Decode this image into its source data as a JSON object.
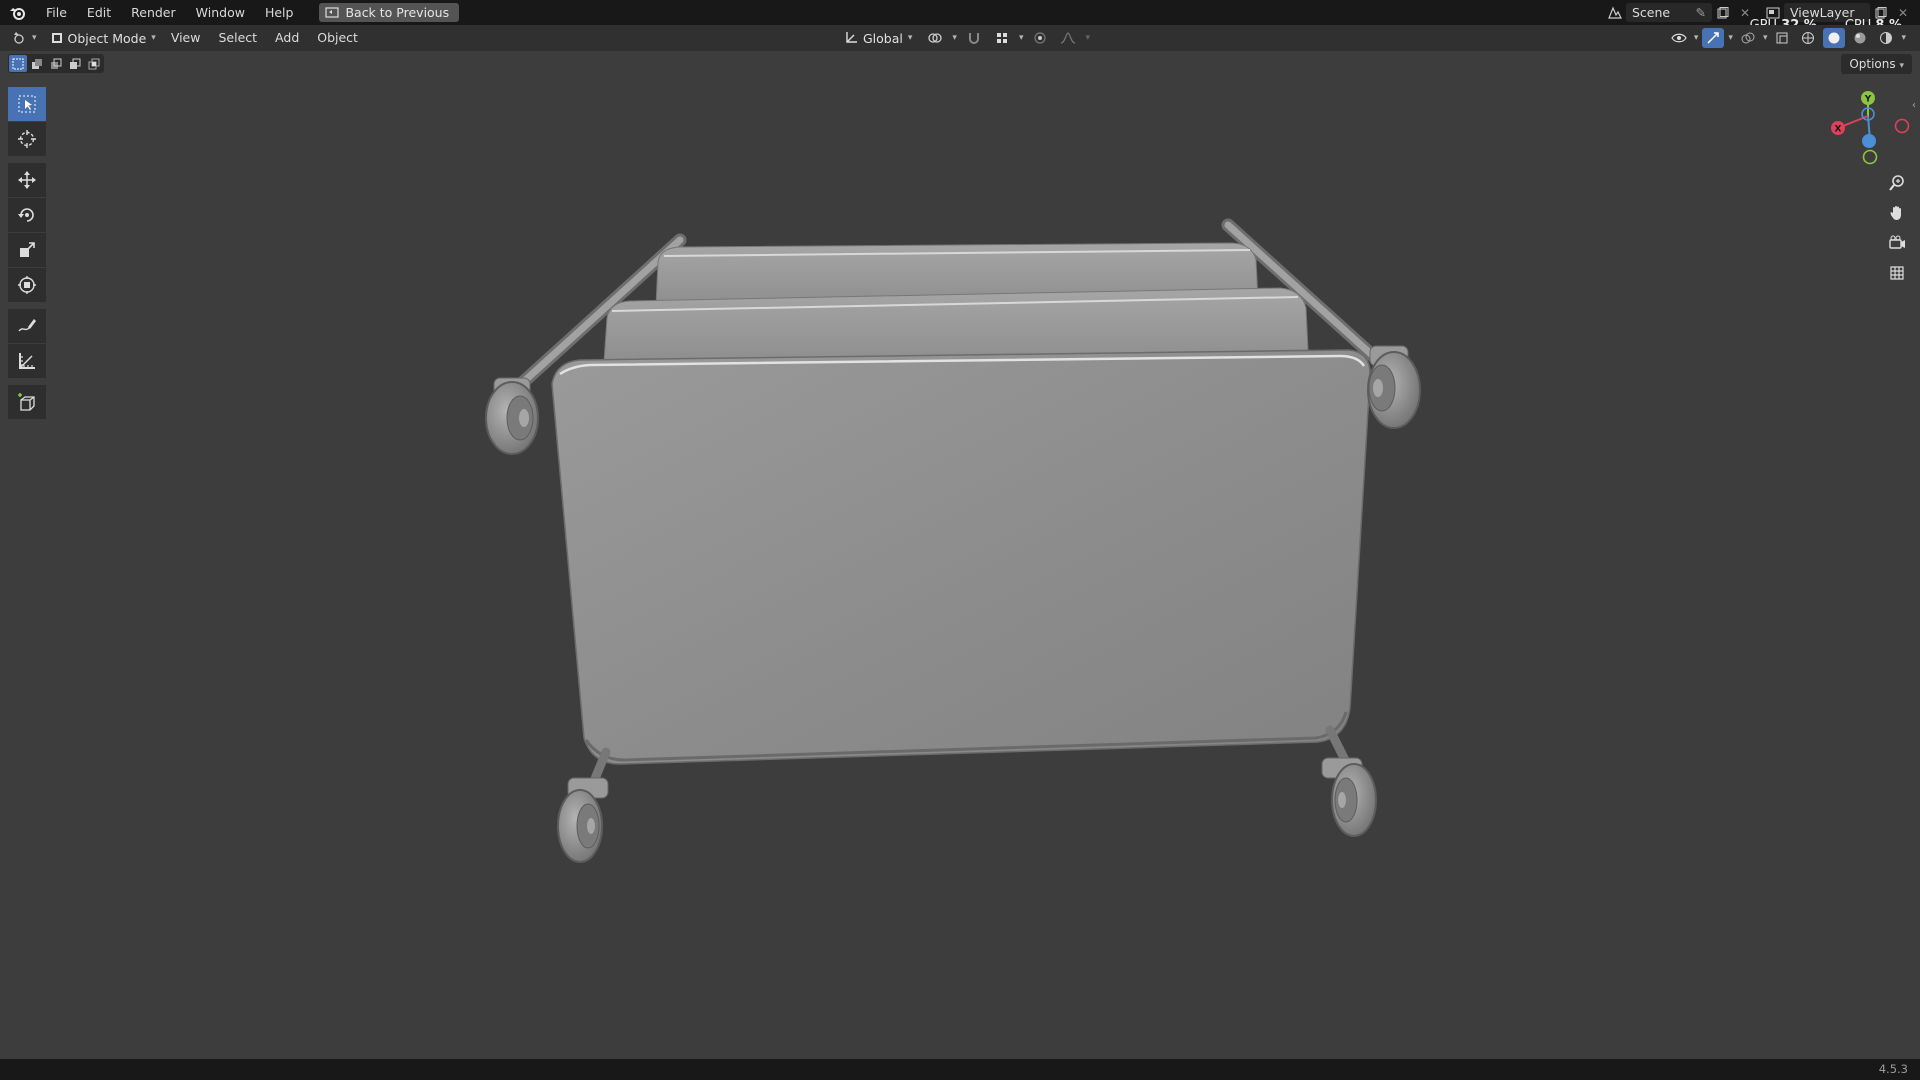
{
  "menu": {
    "items": [
      "File",
      "Edit",
      "Render",
      "Window",
      "Help"
    ],
    "back_button": "Back to Previous"
  },
  "scene": {
    "name": "Scene",
    "view_layer": "ViewLayer"
  },
  "perf": {
    "gpu_label": "GPU",
    "gpu_value": "32 %",
    "cpu_label": "CPU",
    "cpu_value": "8 %"
  },
  "viewport_header": {
    "mode": "Object Mode",
    "menus": [
      "View",
      "Select",
      "Add",
      "Object"
    ],
    "orientation": "Global"
  },
  "options_label": "Options",
  "gizmo": {
    "x": "X",
    "y": "Y",
    "colors": {
      "x": "#e0405a",
      "y": "#8cc63f",
      "z": "#4b8fd6"
    }
  },
  "tools": [
    "select-box",
    "cursor",
    "move",
    "rotate",
    "scale",
    "transform",
    "annotate",
    "measure",
    "add-cube"
  ],
  "version": "4.5.3",
  "colors": {
    "accent": "#4772b3",
    "viewport_bg": "#3d3d3d",
    "header_bg": "#303030",
    "topbar_bg": "#181818",
    "mesh": "#8c8c8c"
  }
}
